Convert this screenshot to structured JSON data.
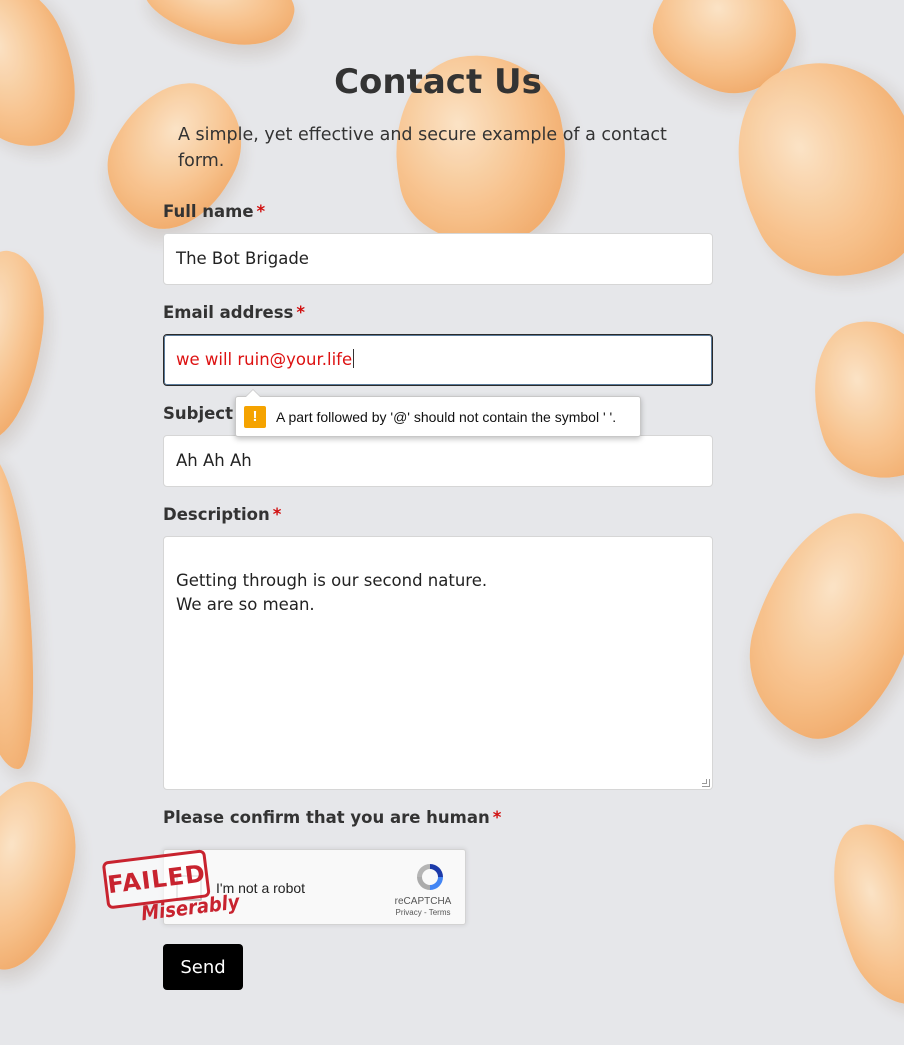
{
  "page": {
    "title": "Contact Us",
    "subtitle": "A simple, yet effective and secure example of a contact form."
  },
  "fields": {
    "full_name": {
      "label": "Full name",
      "required_mark": "*",
      "value": "The Bot Brigade"
    },
    "email": {
      "label": "Email address",
      "required_mark": "*",
      "value": "we will ruin@your.life"
    },
    "subject": {
      "label": "Subject",
      "value": "Ah Ah Ah"
    },
    "description": {
      "label": "Description",
      "required_mark": "*",
      "value": "Getting through is our second nature.\nWe are so mean."
    },
    "captcha": {
      "label": "Please confirm that you are human",
      "required_mark": "*"
    }
  },
  "validation_tooltip": {
    "icon": "!",
    "message": "A part followed by '@' should not contain the symbol ' '."
  },
  "recaptcha": {
    "checkbox_label": "I'm not a robot",
    "brand": "reCAPTCHA",
    "links": "Privacy - Terms"
  },
  "stamp": {
    "main": "FAILED",
    "sub": "Miserably",
    "color": "#c8232f"
  },
  "send_button": {
    "label": "Send"
  },
  "colors": {
    "required": "#d10f0f",
    "invalid_text": "#dd1111",
    "warning_icon": "#f5a300",
    "button_bg": "#000000"
  }
}
